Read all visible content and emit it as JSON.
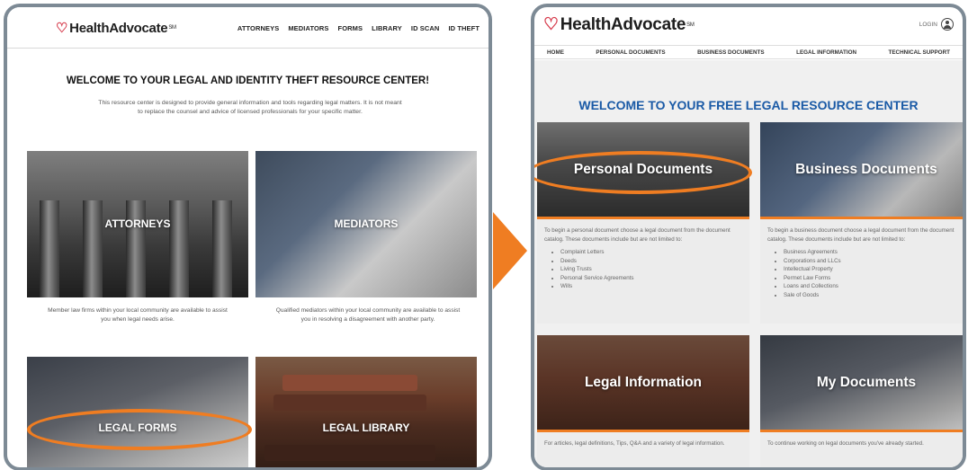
{
  "colors": {
    "accent": "#ef7d22",
    "frame": "#7d8a95",
    "brand_heart": "#d63b4c",
    "welcome_blue": "#1a5aa6"
  },
  "left_site": {
    "logo": {
      "text": "HealthAdvocate",
      "tm": "SM"
    },
    "nav": [
      "ATTORNEYS",
      "MEDIATORS",
      "FORMS",
      "LIBRARY",
      "ID SCAN",
      "ID THEFT"
    ],
    "welcome": "WELCOME TO YOUR LEGAL AND IDENTITY THEFT RESOURCE CENTER!",
    "intro": "This resource center is designed to provide general information and tools regarding legal matters. It is not meant to replace the counsel and advice of licensed professionals for your specific matter.",
    "tiles": {
      "attorneys": {
        "label": "ATTORNEYS",
        "caption": "Member law firms within your local community are available to assist you when legal needs arise."
      },
      "mediators": {
        "label": "MEDIATORS",
        "caption": "Qualified mediators within your local community are available to assist you in resolving a disagreement with another party."
      },
      "legal_forms": {
        "label": "LEGAL FORMS"
      },
      "legal_library": {
        "label": "LEGAL LIBRARY"
      }
    }
  },
  "right_site": {
    "logo": {
      "text": "HealthAdvocate",
      "tm": "SM"
    },
    "login": "LOGIN",
    "nav": [
      "HOME",
      "PERSONAL DOCUMENTS",
      "BUSINESS DOCUMENTS",
      "LEGAL INFORMATION",
      "TECHNICAL SUPPORT"
    ],
    "welcome": "WELCOME TO YOUR FREE LEGAL RESOURCE CENTER",
    "cards": {
      "personal": {
        "label": "Personal Documents",
        "desc": "To begin a personal document choose a legal document from the document catalog. These documents include but are not limited to:",
        "items": [
          "Complaint Letters",
          "Deeds",
          "Living Trusts",
          "Personal Service Agreements",
          "Wills"
        ]
      },
      "business": {
        "label": "Business Documents",
        "desc": "To begin a business document choose a legal document from the document catalog. These documents include but are not limited to:",
        "items": [
          "Business Agreements",
          "Corporations and LLCs",
          "Intellectual Property",
          "Permet Law Forms",
          "Loans and Collections",
          "Sale of Goods"
        ]
      },
      "legal": {
        "label": "Legal Information",
        "desc": "For articles, legal definitions, Tips, Q&A and a variety of legal information."
      },
      "mydocs": {
        "label": "My Documents",
        "desc": "To continue working on legal documents you've already started."
      }
    }
  }
}
